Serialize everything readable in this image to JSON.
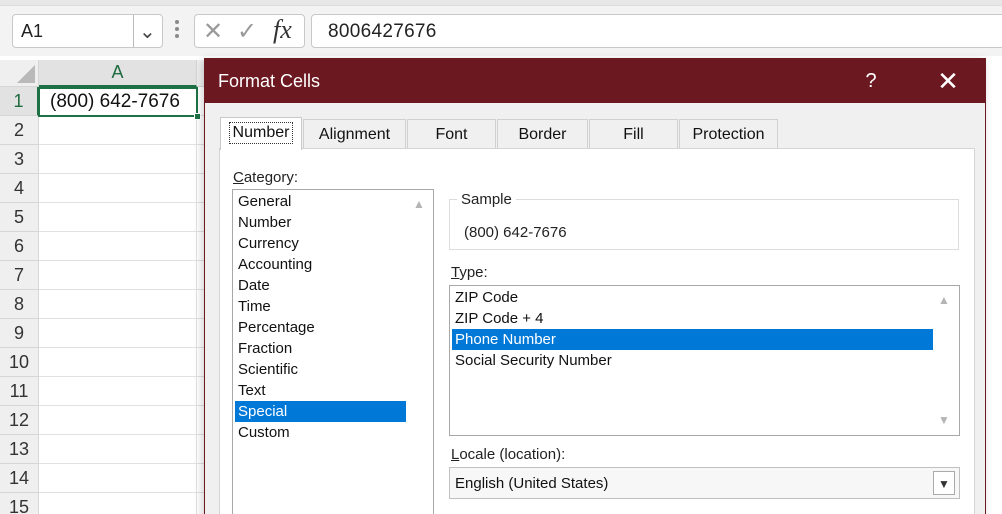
{
  "formula_bar": {
    "name_box": "A1",
    "name_box_chevron": "chevron-down-icon",
    "cancel_glyph": "✕",
    "enter_glyph": "✓",
    "fx_label": "fx",
    "formula_value": "8006427676"
  },
  "sheet": {
    "column_header": "A",
    "rows": [
      "1",
      "2",
      "3",
      "4",
      "5",
      "6",
      "7",
      "8",
      "9",
      "10",
      "11",
      "12",
      "13",
      "14",
      "15"
    ],
    "cell_a1": "(800) 642-7676",
    "selection_color": "#1e7145"
  },
  "dialog": {
    "title": "Format Cells",
    "help_label": "?",
    "close_label": "✕",
    "titlebar_color": "#6c1820",
    "tabs": [
      "Number",
      "Alignment",
      "Font",
      "Border",
      "Fill",
      "Protection"
    ],
    "active_tab": "Number",
    "category_label_accel": "C",
    "category_label_rest": "ategory:",
    "categories": [
      "General",
      "Number",
      "Currency",
      "Accounting",
      "Date",
      "Time",
      "Percentage",
      "Fraction",
      "Scientific",
      "Text",
      "Special",
      "Custom"
    ],
    "selected_category": "Special",
    "sample_label": "Sample",
    "sample_value": "(800) 642-7676",
    "type_label_accel": "T",
    "type_label_rest": "ype:",
    "types": [
      "ZIP Code",
      "ZIP Code + 4",
      "Phone Number",
      "Social Security Number"
    ],
    "selected_type": "Phone Number",
    "locale_label_accel": "L",
    "locale_label_rest": "ocale (location):",
    "locale_value": "English (United States)",
    "selection_color": "#0078d7"
  }
}
